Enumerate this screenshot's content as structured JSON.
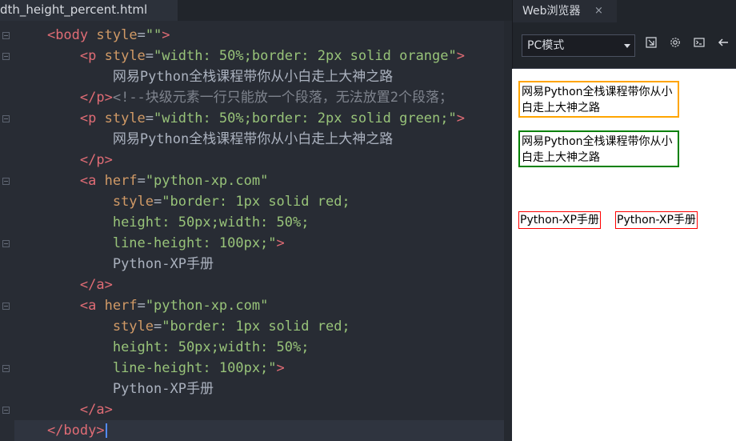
{
  "editor": {
    "tab_title": "dth_height_percent.html",
    "lines": [
      {
        "indent": "    ",
        "parts": [
          [
            "tag",
            "<body "
          ],
          [
            "attr",
            "style"
          ],
          [
            "txt",
            "="
          ],
          [
            "str",
            "\"\""
          ],
          [
            "tag",
            ">"
          ]
        ]
      },
      {
        "indent": "        ",
        "parts": [
          [
            "tag",
            "<p "
          ],
          [
            "attr",
            "style"
          ],
          [
            "txt",
            "="
          ],
          [
            "str",
            "\"width: 50%;border: 2px solid orange\""
          ],
          [
            "tag",
            ">"
          ]
        ]
      },
      {
        "indent": "            ",
        "parts": [
          [
            "txt",
            "网易Python全栈课程带你从小白走上大神之路"
          ]
        ]
      },
      {
        "indent": "        ",
        "parts": [
          [
            "tag",
            "</p>"
          ],
          [
            "cmt",
            "<!--块级元素一行只能放一个段落，无法放置2个段落；"
          ]
        ]
      },
      {
        "indent": "        ",
        "parts": [
          [
            "tag",
            "<p "
          ],
          [
            "attr",
            "style"
          ],
          [
            "txt",
            "="
          ],
          [
            "str",
            "\"width: 50%;border: 2px solid green;\""
          ],
          [
            "tag",
            ">"
          ]
        ]
      },
      {
        "indent": "            ",
        "parts": [
          [
            "txt",
            "网易Python全栈课程带你从小白走上大神之路"
          ]
        ]
      },
      {
        "indent": "        ",
        "parts": [
          [
            "tag",
            "</p>"
          ]
        ]
      },
      {
        "indent": "        ",
        "parts": [
          [
            "tag",
            "<a "
          ],
          [
            "attr",
            "herf"
          ],
          [
            "txt",
            "="
          ],
          [
            "str",
            "\"python-xp.com\""
          ]
        ]
      },
      {
        "indent": "            ",
        "parts": [
          [
            "attr",
            "style"
          ],
          [
            "txt",
            "="
          ],
          [
            "str",
            "\"border: 1px solid red;"
          ]
        ]
      },
      {
        "indent": "            ",
        "parts": [
          [
            "str",
            "height: 50px;width: 50%;"
          ]
        ]
      },
      {
        "indent": "            ",
        "parts": [
          [
            "str",
            "line-height: 100px;\""
          ],
          [
            "tag",
            ">"
          ]
        ]
      },
      {
        "indent": "            ",
        "parts": [
          [
            "txt",
            "Python-XP手册"
          ]
        ]
      },
      {
        "indent": "        ",
        "parts": [
          [
            "tag",
            "</a>"
          ]
        ]
      },
      {
        "indent": "        ",
        "parts": [
          [
            "tag",
            "<a "
          ],
          [
            "attr",
            "herf"
          ],
          [
            "txt",
            "="
          ],
          [
            "str",
            "\"python-xp.com\""
          ]
        ]
      },
      {
        "indent": "            ",
        "parts": [
          [
            "attr",
            "style"
          ],
          [
            "txt",
            "="
          ],
          [
            "str",
            "\"border: 1px solid red;"
          ]
        ]
      },
      {
        "indent": "            ",
        "parts": [
          [
            "str",
            "height: 50px;width: 50%;"
          ]
        ]
      },
      {
        "indent": "            ",
        "parts": [
          [
            "str",
            "line-height: 100px;\""
          ],
          [
            "tag",
            ">"
          ]
        ]
      },
      {
        "indent": "            ",
        "parts": [
          [
            "txt",
            "Python-XP手册"
          ]
        ]
      },
      {
        "indent": "        ",
        "parts": [
          [
            "tag",
            "</a>"
          ]
        ]
      },
      {
        "indent": "    ",
        "parts": [
          [
            "tag",
            "</body>"
          ]
        ]
      }
    ]
  },
  "browser": {
    "tab_label": "Web浏览器",
    "tab_close": "×",
    "mode_value": "PC模式",
    "icons": [
      "screenshot-icon",
      "settings-icon",
      "console-icon",
      "back-arrow-icon"
    ],
    "preview": {
      "p1_text": "网易Python全栈课程带你从小白走上大神之路",
      "p2_text": "网易Python全栈课程带你从小白走上大神之路",
      "link1_text": "Python-XP手册",
      "link2_text": "Python-XP手册"
    }
  },
  "colors": {
    "tag": "#e06c75",
    "attr": "#d19a66",
    "string": "#98c379",
    "comment": "#7f848e",
    "editor_bg": "#282c34",
    "p1_border": "orange",
    "p2_border": "green",
    "link_border": "red"
  }
}
